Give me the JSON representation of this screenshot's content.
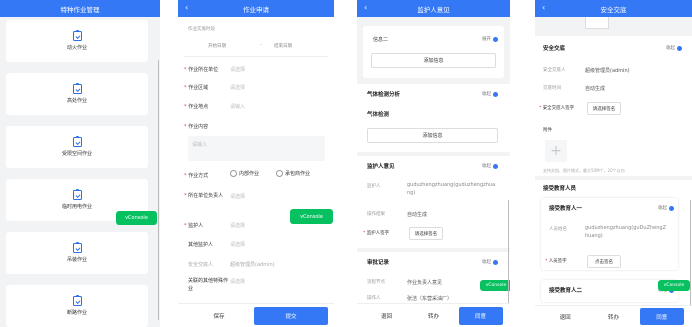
{
  "p1": {
    "title": "特种作业管理",
    "cards": [
      "动火作业",
      "高处作业",
      "受限空间作业",
      "临时用电作业",
      "吊装作业",
      "断路作业"
    ],
    "vconsole": "vConsole"
  },
  "p2": {
    "title": "作业申请",
    "time_label": "作业实施时段",
    "start_placeholder": "开始日期",
    "sep": "-",
    "end_placeholder": "结束日期",
    "fields": [
      {
        "label": "作业所在单位",
        "value": "请选择"
      },
      {
        "label": "作业区域",
        "value": "请选择"
      },
      {
        "label": "作业地点",
        "value": "请输入"
      },
      {
        "label": "作业内容",
        "value": ""
      }
    ],
    "content_placeholder": "请输入",
    "type_label": "作业方式",
    "radio1": "内部作业",
    "radio2": "承包商作业",
    "resp_label": "所在单位负责人",
    "resp_value": "请选择",
    "guardian_label": "监护人",
    "guardian_value": "请选择",
    "other_guardian_label": "其他监护人",
    "other_guardian_value": "请选择",
    "safety_label": "安全交底人",
    "safety_value": "超级管理员(admin)",
    "other_work_label": "关联的其他特殊作业",
    "other_work_value": "请选择",
    "save": "保存",
    "submit": "提交",
    "vconsole": "vConsole"
  },
  "p3": {
    "title": "监护人意见",
    "info2": "信息二",
    "expand": "展开",
    "add_info": "添加信息",
    "gas_section": "气体检测分析",
    "collapse": "收起",
    "gas_title": "气体检测",
    "add_info2": "添加信息",
    "opinion_section": "监护人意见",
    "collapse2": "收起",
    "guardian_key": "监护人",
    "guardian_value": "guduzhengzhuang(guduzhengzhuang)",
    "result_key": "操作结果",
    "result_value": "自动生成",
    "sign_key": "监护人签字",
    "sign_btn": "请选择签名",
    "audit_section": "审批记录",
    "collapse3": "收起",
    "node_key": "流程节点",
    "node_value": "作业负责人意见",
    "op_key": "操作人",
    "op_value": "张洁（东营采油厂）",
    "vconsole": "vConsole",
    "back_btn": "退回",
    "transfer_btn": "转办",
    "agree_btn": "同意"
  },
  "p4": {
    "title": "安全交底",
    "section_title": "安全交底",
    "collapse": "收起",
    "person_key": "安全交底人",
    "person_value": "超级管理员(admin)",
    "time_key": "交底时间",
    "time_value": "自动生成",
    "sign_key": "安全交底人签字",
    "sign_btn": "请选择签名",
    "attach_label": "附件",
    "attach_hint": "支持文档、图片格式，最大50M个，20个以内",
    "edu_section": "接受教育人员",
    "edu1_title": "接受教育人一",
    "collapse2": "收起",
    "edu_person_key": "人员姓名",
    "edu_person_value": "guduzhengzhuang(guDuZhengZhuang)",
    "edu_sign_key": "人员签字",
    "edu_sign_btn": "点击签名",
    "edu2_title": "接受教育人二",
    "collapse3": "收起",
    "vconsole": "vConsole",
    "back_btn": "退回",
    "transfer_btn": "转办",
    "agree_btn": "同意"
  }
}
